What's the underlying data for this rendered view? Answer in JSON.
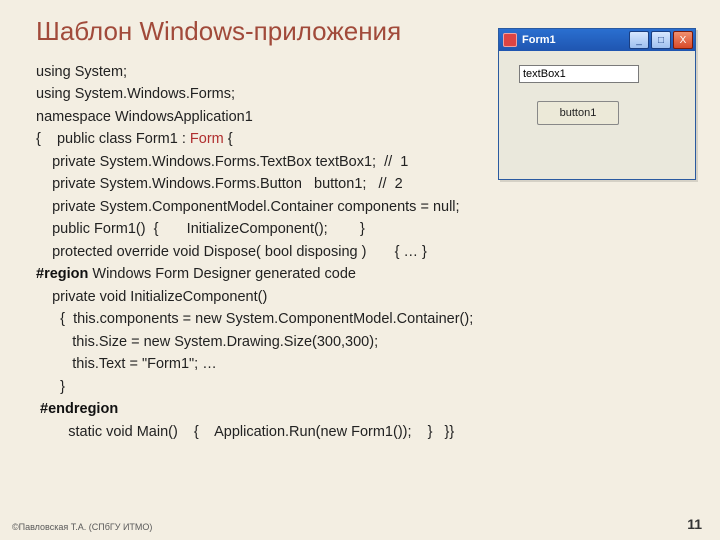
{
  "slide": {
    "title": "Шаблон Windows-приложения",
    "code": {
      "l1": "using System;",
      "l2": "using System.Windows.Forms;",
      "l3": "namespace WindowsApplication1",
      "l4a": "{    public class Form1 : ",
      "l4b": "Form",
      "l4c": " {",
      "l5": "    private System.Windows.Forms.TextBox textBox1;  //  1",
      "l6": "    private System.Windows.Forms.Button   button1;   //  2",
      "l7": "    private System.ComponentModel.Container components = null;",
      "l8": "    public Form1()  {       InitializeComponent();        }",
      "l9": "    protected override void Dispose( bool disposing )       { … }",
      "l10a": "#region",
      "l10b": " Windows Form Designer generated code",
      "l11": "    private void InitializeComponent()",
      "l12": "      {  this.components = new System.ComponentModel.Container();",
      "l13": "         this.Size = new System.Drawing.Size(300,300);",
      "l14": "         this.Text = \"Form1\"; …",
      "l15": "      }",
      "l16": " #endregion",
      "l17": "        static void Main()    {    Application.Run(new Form1());    }   }}"
    },
    "footer_left": "©Павловская Т.А. (СПбГУ ИТМО)",
    "page_number": "11"
  },
  "winform": {
    "title": "Form1",
    "textbox_value": "textBox1",
    "button_label": "button1",
    "min_glyph": "_",
    "max_glyph": "□",
    "close_glyph": "X"
  }
}
